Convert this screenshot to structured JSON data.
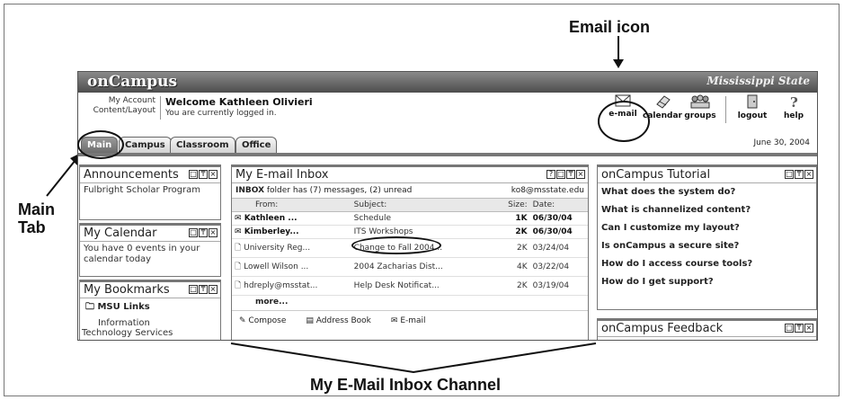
{
  "annotations": {
    "email_icon": "Email icon",
    "main_tab": "Main\nTab",
    "channel": "My E-Mail Inbox Channel"
  },
  "header": {
    "logo": "onCampus",
    "brand": "Mississippi State",
    "account_line1": "My Account",
    "account_line2": "Content/Layout",
    "welcome": "Welcome Kathleen Olivieri",
    "logged_in": "You are currently logged in.",
    "tools": {
      "email": "e-mail",
      "calendar": "calendar",
      "groups": "groups",
      "logout": "logout",
      "help": "help"
    }
  },
  "tabs": [
    {
      "label": "Main",
      "active": true
    },
    {
      "label": "Campus"
    },
    {
      "label": "Classroom"
    },
    {
      "label": "Office"
    }
  ],
  "date": "June 30, 2004",
  "announcements": {
    "title": "Announcements",
    "item": "Fulbright Scholar Program"
  },
  "calendar": {
    "title": "My Calendar",
    "text": "You have 0 events in your calendar today"
  },
  "bookmarks": {
    "title": "My Bookmarks",
    "folder": "MSU Links",
    "item_line1": "Information",
    "item_line2": "Technology Services"
  },
  "inbox": {
    "title": "My E-mail Inbox",
    "summary_folder": "INBOX",
    "summary_rest": " folder has (7) messages, (2) unread",
    "account": "ko8@msstate.edu",
    "columns": [
      "From:",
      "Subject:",
      "Size:",
      "Date:"
    ],
    "rows": [
      {
        "from": "Kathleen ...",
        "subject": "Schedule",
        "size": "1K",
        "date": "06/30/04",
        "unread": true
      },
      {
        "from": "Kimberley...",
        "subject": "ITS Workshops",
        "size": "2K",
        "date": "06/30/04",
        "unread": true
      },
      {
        "from": "University Reg...",
        "subject": "Change to Fall 2004...",
        "size": "2K",
        "date": "03/24/04",
        "unread": false
      },
      {
        "from": "Lowell Wilson ...",
        "subject": "2004 Zacharias Dist...",
        "size": "4K",
        "date": "03/22/04",
        "unread": false
      },
      {
        "from": "hdreply@msstat...",
        "subject": "Help Desk Notificat...",
        "size": "2K",
        "date": "03/19/04",
        "unread": false
      }
    ],
    "more": "more...",
    "footer": {
      "compose": "Compose",
      "address_book": "Address Book",
      "email": "E-mail"
    }
  },
  "tutorial": {
    "title": "onCampus Tutorial",
    "links": [
      "What does the system do?",
      "What is channelized content?",
      "Can I customize my layout?",
      "Is onCampus a secure site?",
      "How do I access course tools?",
      "How do I get support?"
    ]
  },
  "feedback": {
    "title": "onCampus Feedback"
  },
  "panel_controls": [
    "□",
    "₸",
    "×"
  ]
}
